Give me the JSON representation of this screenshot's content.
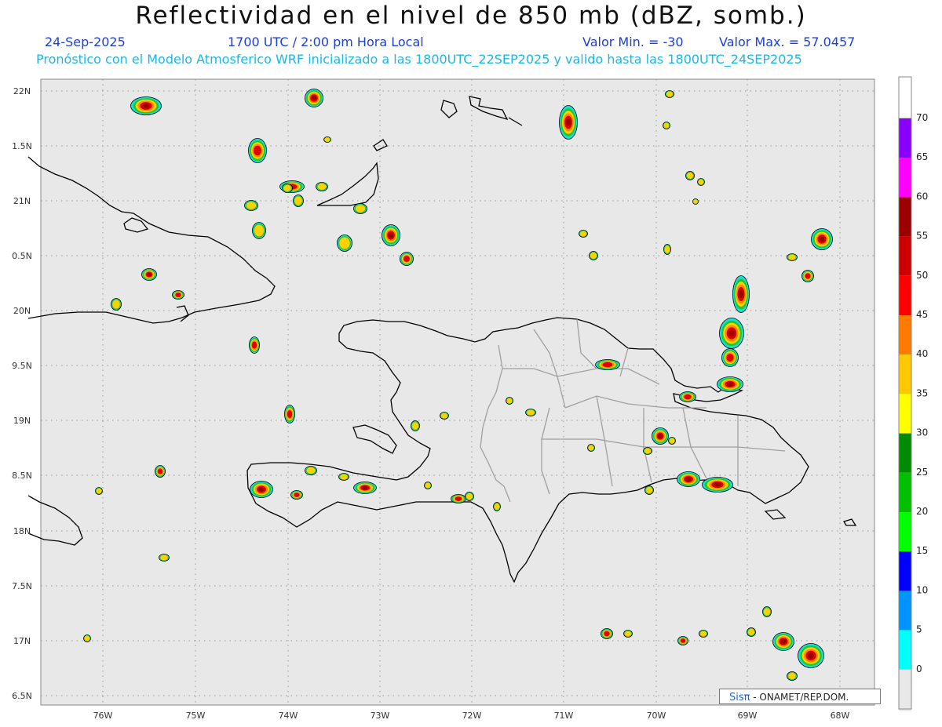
{
  "header": {
    "title": "Reflectividad en el nivel de 850 mb (dBZ, somb.)",
    "date": "24-Sep-2025",
    "time": "1700 UTC / 2:00 pm Hora Local",
    "valmin": "Valor Min. = -30",
    "valmax": "Valor Max. = 57.0457",
    "forecast": "Pronóstico con el Modelo Atmosferico WRF inicializado a las 1800UTC_22SEP2025 y valido hasta las  1800UTC_24SEP2025"
  },
  "axes": {
    "x_ticks": [
      "76W",
      "75W",
      "74W",
      "73W",
      "72W",
      "71W",
      "70W",
      "69W",
      "68W"
    ],
    "y_ticks": [
      "22N",
      "1.5N",
      "21N",
      "0.5N",
      "20N",
      "9.5N",
      "19N",
      "8.5N",
      "18N",
      "7.5N",
      "17N",
      "6.5N"
    ]
  },
  "colorbar": {
    "labels": [
      "70",
      "65",
      "60",
      "55",
      "50",
      "45",
      "40",
      "35",
      "30",
      "25",
      "20",
      "15",
      "10",
      "5",
      "0"
    ],
    "colors": [
      "#8a00ff",
      "#ff00ff",
      "#9a0000",
      "#cc0000",
      "#ff0000",
      "#ff7a00",
      "#ffc800",
      "#ffff00",
      "#008c00",
      "#00c000",
      "#00ff00",
      "#0000ff",
      "#0094ff",
      "#00ffff",
      "#e8e8e8"
    ],
    "top_color": "#ffffff"
  },
  "colors": {
    "map_bg": "#e8e8e8",
    "coast": "#000000",
    "province": "#9a9a9a"
  },
  "credit": {
    "brand_a": "Sis",
    "brand_b": "π",
    "rest": " -  ONAMET/REP.DOM."
  }
}
